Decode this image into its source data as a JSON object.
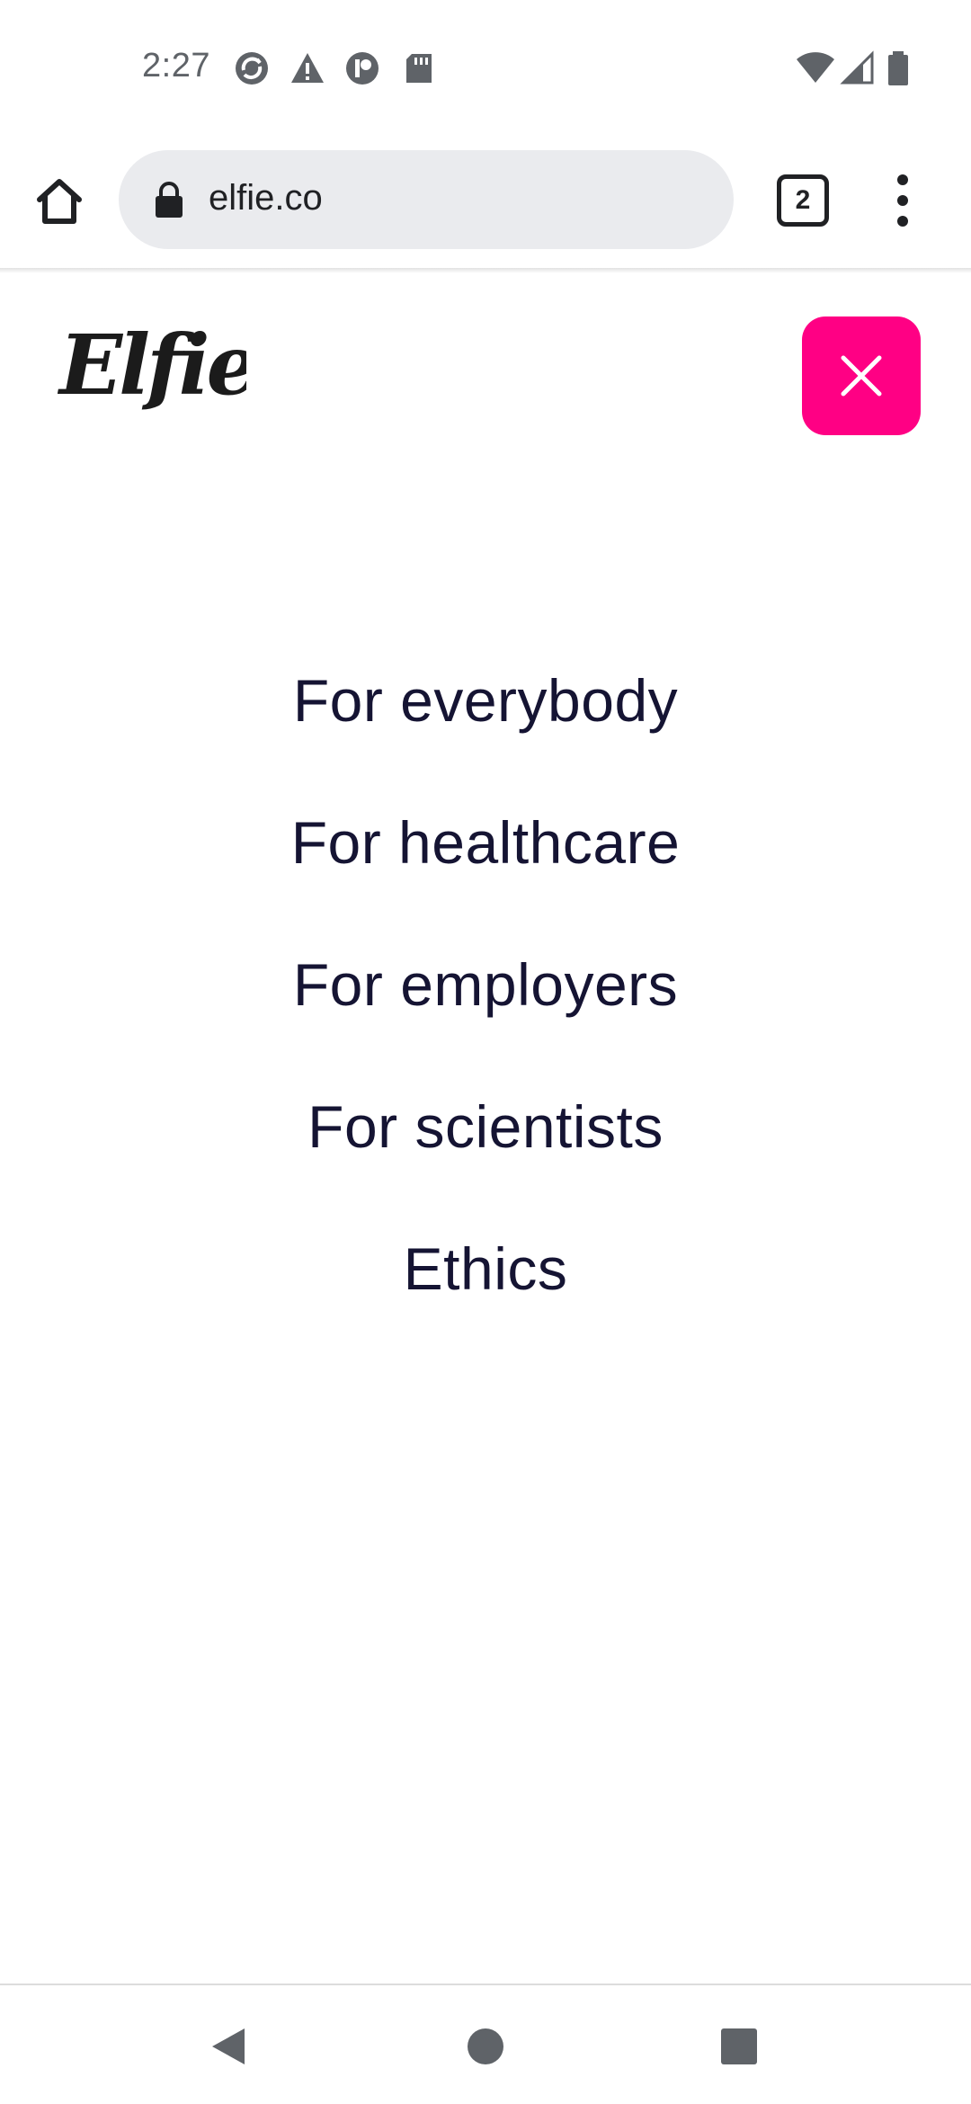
{
  "status_bar": {
    "time": "2:27",
    "notification_icons": [
      "sync-icon",
      "warning-icon",
      "app-icon",
      "sd-card-icon"
    ],
    "system_icons": [
      "wifi-icon",
      "cellular-signal-icon",
      "battery-icon"
    ]
  },
  "browser": {
    "url": "elfie.co",
    "tab_count": "2",
    "icons": [
      "home-icon",
      "lock-icon",
      "more-vert-icon"
    ]
  },
  "site": {
    "logo_text": "Elfie",
    "close_icon": "close-icon",
    "accent_color": "#ff0084",
    "text_color": "#151433"
  },
  "menu": {
    "items": [
      {
        "label": "For everybody"
      },
      {
        "label": "For healthcare"
      },
      {
        "label": "For employers"
      },
      {
        "label": "For scientists"
      },
      {
        "label": "Ethics"
      }
    ]
  },
  "system_nav": {
    "icons": [
      "back-icon",
      "home-circle-icon",
      "recents-icon"
    ]
  }
}
